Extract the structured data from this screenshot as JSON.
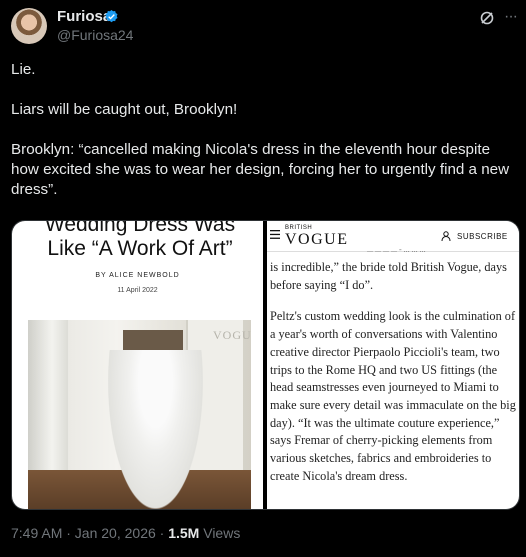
{
  "author": {
    "name": "Furiosa",
    "handle": "@Furiosa24"
  },
  "tweet": {
    "paragraphs": [
      "Lie.",
      "Liars will be caught out, Brooklyn!",
      "Brooklyn: “cancelled making Nicola's dress in the eleventh hour despite how excited she was to wear her design, forcing her to urgently find a new dress”."
    ]
  },
  "media": {
    "left": {
      "title": "Wedding Dress Was Like “A Work Of Art”",
      "byline": "BY ALICE NEWBOLD",
      "date": "11 April 2022",
      "photo_logo": "VOGUE"
    },
    "right": {
      "site_small": "BRITISH",
      "site_logo": "VOGUE",
      "subscribe_label": "SUBSCRIBE",
      "cut_line": "... ... ... ... - ... ... ...",
      "paragraphs": [
        "is incredible,” the bride told British Vogue, days before saying “I do”.",
        "Peltz's custom wedding look is the culmination of a year's worth of conversations with Valentino creative director Pierpaolo Piccioli's team, two trips to the Rome HQ and two US fittings (the head seamstresses even journeyed to Miami to make sure every detail was immaculate on the big day). “It was the ultimate couture experience,” says Fremar of cherry-picking elements from various sketches, fabrics and embroideries to create Nicola's dream dress."
      ]
    }
  },
  "footer": {
    "timestamp": "7:49 AM · Jan 20, 2026 · ",
    "views_count": "1.5M",
    "views_label": " Views"
  },
  "colors": {
    "background": "#000000",
    "text": "#e7e9ea",
    "muted": "#71767b",
    "verified": "#1d9bf0"
  },
  "icons": [
    "verified-icon",
    "grok-icon",
    "more-icon",
    "menu-icon",
    "person-icon"
  ]
}
